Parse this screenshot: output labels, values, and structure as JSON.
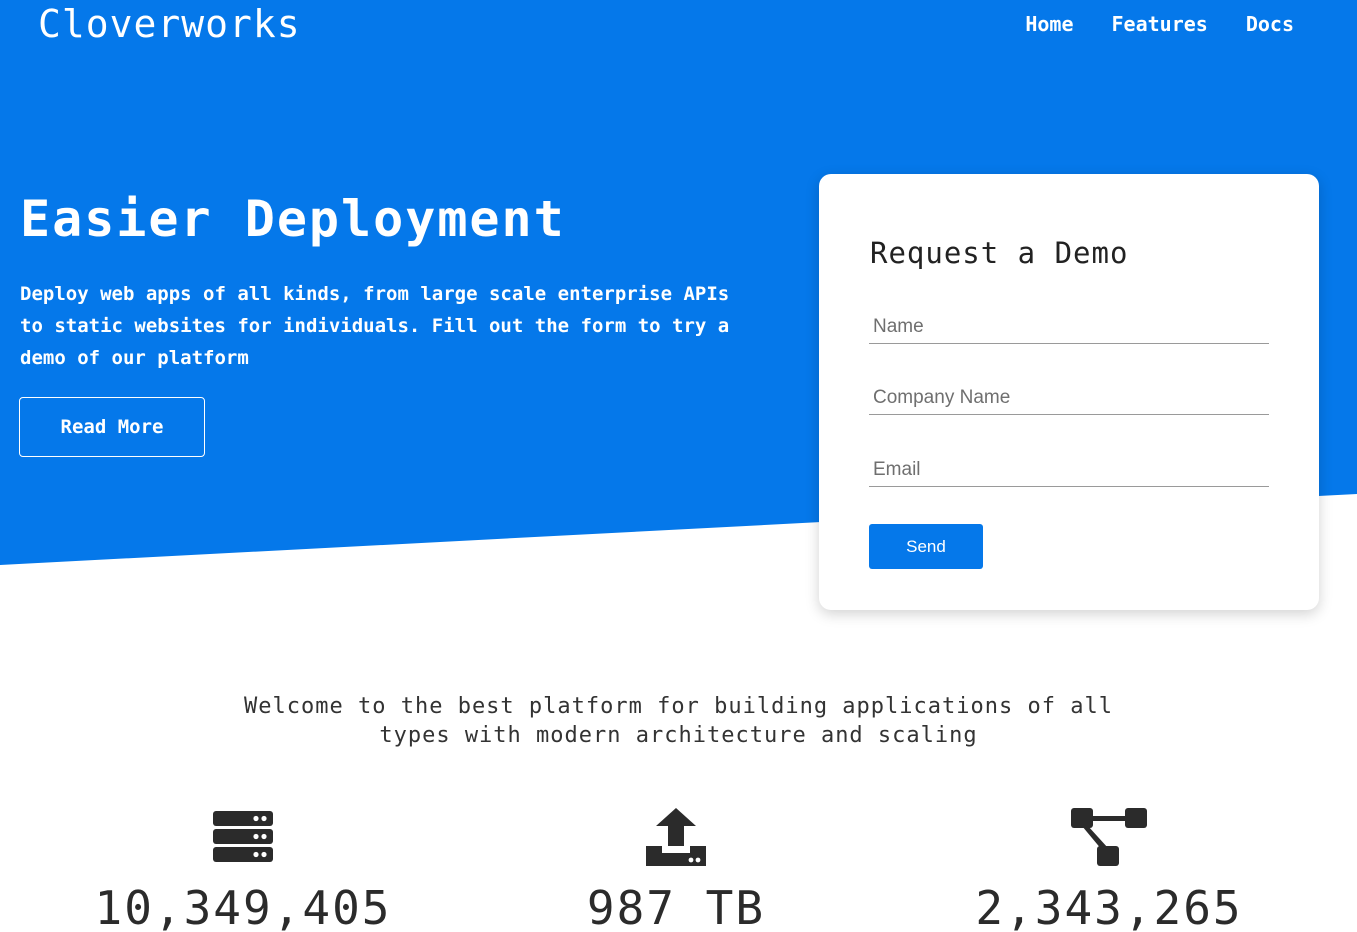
{
  "header": {
    "brand": "Cloverworks",
    "nav": [
      {
        "label": "Home"
      },
      {
        "label": "Features"
      },
      {
        "label": "Docs"
      }
    ]
  },
  "hero": {
    "title": "Easier Deployment",
    "text": "Deploy web apps of all kinds, from large scale enterprise APIs to static websites for individuals. Fill out the form to try a demo of our platform",
    "read_more_label": "Read More"
  },
  "demo_form": {
    "title": "Request a Demo",
    "name_placeholder": "Name",
    "company_placeholder": "Company Name",
    "email_placeholder": "Email",
    "send_label": "Send"
  },
  "welcome": {
    "line1": "Welcome to the best platform for building applications of all",
    "line2": "types with modern architecture and scaling"
  },
  "stats": [
    {
      "icon": "server-icon",
      "value": "10,349,405"
    },
    {
      "icon": "upload-icon",
      "value": "987 TB"
    },
    {
      "icon": "sitemap-icon",
      "value": "2,343,265"
    }
  ],
  "colors": {
    "primary_blue": "#0578ea",
    "card_background": "#ffffff",
    "text_dark": "#2b2b2b"
  }
}
